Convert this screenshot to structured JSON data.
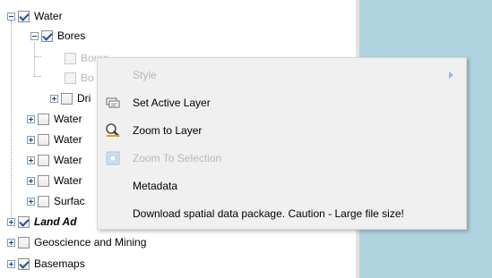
{
  "tree": {
    "items": [
      {
        "label": "Water",
        "checked": true,
        "expanded": true
      },
      {
        "label": "Bores",
        "checked": true,
        "expanded": true
      },
      {
        "label": "Bores",
        "checked": false
      },
      {
        "label": "Bo",
        "checked": false
      },
      {
        "label": "Dri",
        "checked": false
      },
      {
        "label": "Water",
        "checked": false
      },
      {
        "label": "Water",
        "checked": false
      },
      {
        "label": "Water",
        "checked": false
      },
      {
        "label": "Water",
        "checked": false
      },
      {
        "label": "Surfac",
        "checked": false
      },
      {
        "label": "Land Ad",
        "checked": true
      },
      {
        "label": "Geoscience and Mining",
        "checked": false
      },
      {
        "label": "Basemaps",
        "checked": true
      }
    ]
  },
  "context_menu": {
    "items": [
      {
        "label": "Style",
        "disabled": true,
        "has_submenu": true,
        "icon": "none"
      },
      {
        "label": "Set Active Layer",
        "disabled": false,
        "icon": "layers-icon"
      },
      {
        "label": "Zoom to Layer",
        "disabled": false,
        "icon": "magnifier-icon"
      },
      {
        "label": "Zoom To Selection",
        "disabled": true,
        "icon": "selection-icon"
      },
      {
        "label": "Metadata",
        "disabled": false,
        "icon": "none"
      },
      {
        "label": "Download spatial data package. Caution - Large file size!",
        "disabled": false,
        "icon": "none"
      }
    ]
  },
  "colors": {
    "map_background": "#aed3df",
    "menu_background": "#f0f0f0",
    "selection": "#e6eefb"
  }
}
